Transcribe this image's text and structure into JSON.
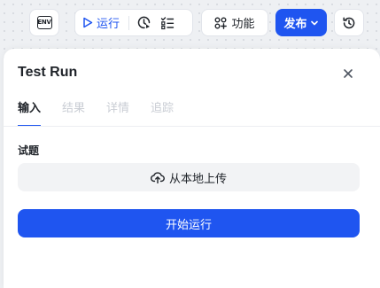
{
  "toolbar": {
    "env_label": "ENV",
    "run_label": "运行",
    "function_label": "功能",
    "publish_label": "发布"
  },
  "panel": {
    "title": "Test Run",
    "tabs": [
      {
        "label": "输入",
        "active": true
      },
      {
        "label": "结果",
        "active": false
      },
      {
        "label": "详情",
        "active": false
      },
      {
        "label": "追踪",
        "active": false
      }
    ],
    "field_label": "试题",
    "upload_label": "从本地上传",
    "start_label": "开始运行"
  },
  "colors": {
    "primary": "#1f55f0",
    "text": "#1f2329",
    "muted": "#c9cdd4",
    "upload_bg": "#f2f3f5"
  },
  "icons": [
    "env-icon",
    "play-icon",
    "clock-check-icon",
    "checklist-icon",
    "function-icon",
    "chevron-down-icon",
    "history-icon",
    "close-icon",
    "cloud-upload-icon"
  ]
}
